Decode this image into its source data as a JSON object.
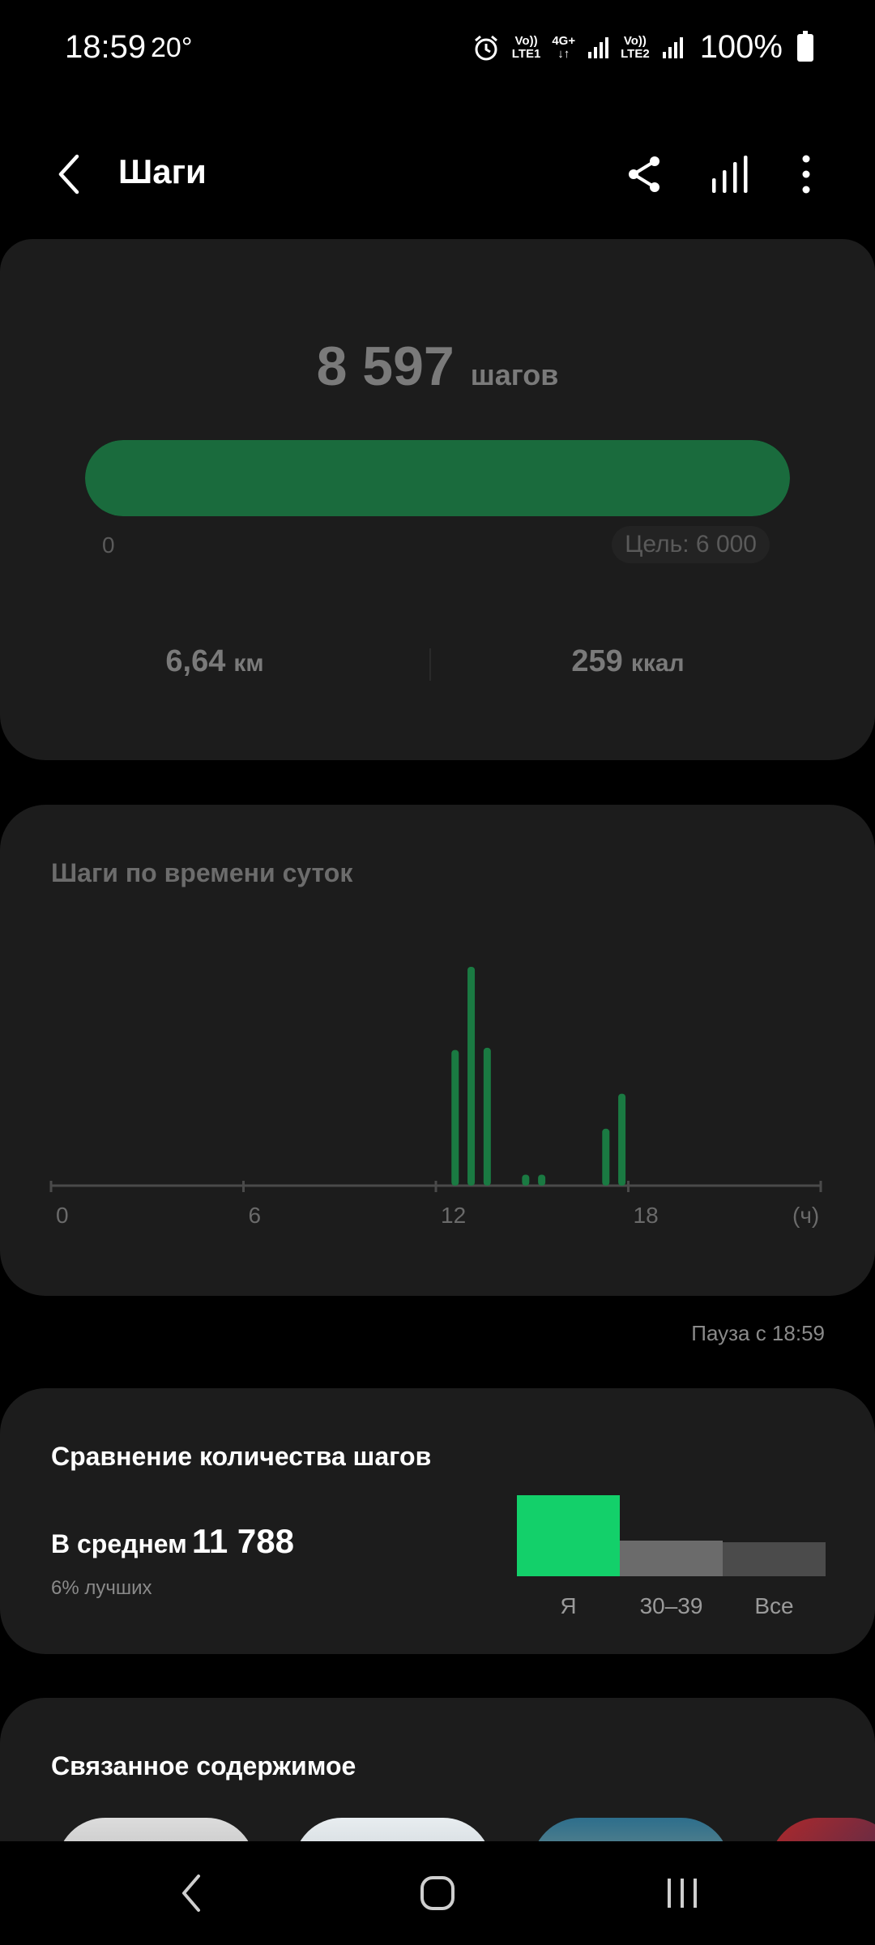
{
  "status_bar": {
    "time": "18:59",
    "temperature": "20°",
    "sim1_label_top": "Vo))",
    "sim1_label_bottom": "LTE1",
    "net_label_top": "4G+",
    "net_label_bottom": "↓↑",
    "sim2_label_top": "Vo))",
    "sim2_label_bottom": "LTE2",
    "battery": "100%"
  },
  "header": {
    "title": "Шаги",
    "icons": [
      "back-arrow-icon",
      "share-icon",
      "bar-chart-icon",
      "more-vertical-icon"
    ]
  },
  "steps_card": {
    "count": "8 597",
    "unit": "шагов",
    "progress_fraction": 1.0,
    "progress_min": "0",
    "goal": "Цель: 6 000",
    "distance_value": "6,64",
    "distance_unit": "км",
    "calories_value": "259",
    "calories_unit": "ккал"
  },
  "hourly_card": {
    "title": "Шаги по времени суток"
  },
  "chart_data": [
    {
      "type": "bar",
      "title": "Шаги по времени суток",
      "x_tick_labels": [
        "0",
        "6",
        "12",
        "18",
        "(ч)"
      ],
      "xlim": [
        0,
        24
      ],
      "x": [
        12.6,
        13.1,
        13.6,
        14.8,
        15.3,
        17.3,
        17.8
      ],
      "values": [
        0.62,
        1.0,
        0.63,
        0.05,
        0.05,
        0.26,
        0.42
      ],
      "value_note_unit": "relative",
      "color": "#1a7a42",
      "grid": false
    },
    {
      "type": "bar",
      "title": "Сравнение количества шагов",
      "categories": [
        "Я",
        "30–39",
        "Все"
      ],
      "values": [
        1.0,
        0.44,
        0.42
      ],
      "colors": [
        "#13d06a",
        "#6b6b6b",
        "#4b4b4b"
      ]
    }
  ],
  "pause": "Пауза с 18:59",
  "compare_card": {
    "title": "Сравнение количества шагов",
    "avg_label": "В среднем",
    "avg_value": "11 788",
    "percentile": "6% лучших"
  },
  "related_card": {
    "title": "Связанное содержимое"
  },
  "colors": {
    "background": "#000000",
    "card": "#1c1c1c",
    "progress_green": "#1a6b3d",
    "highlight_green": "#13d06a"
  }
}
